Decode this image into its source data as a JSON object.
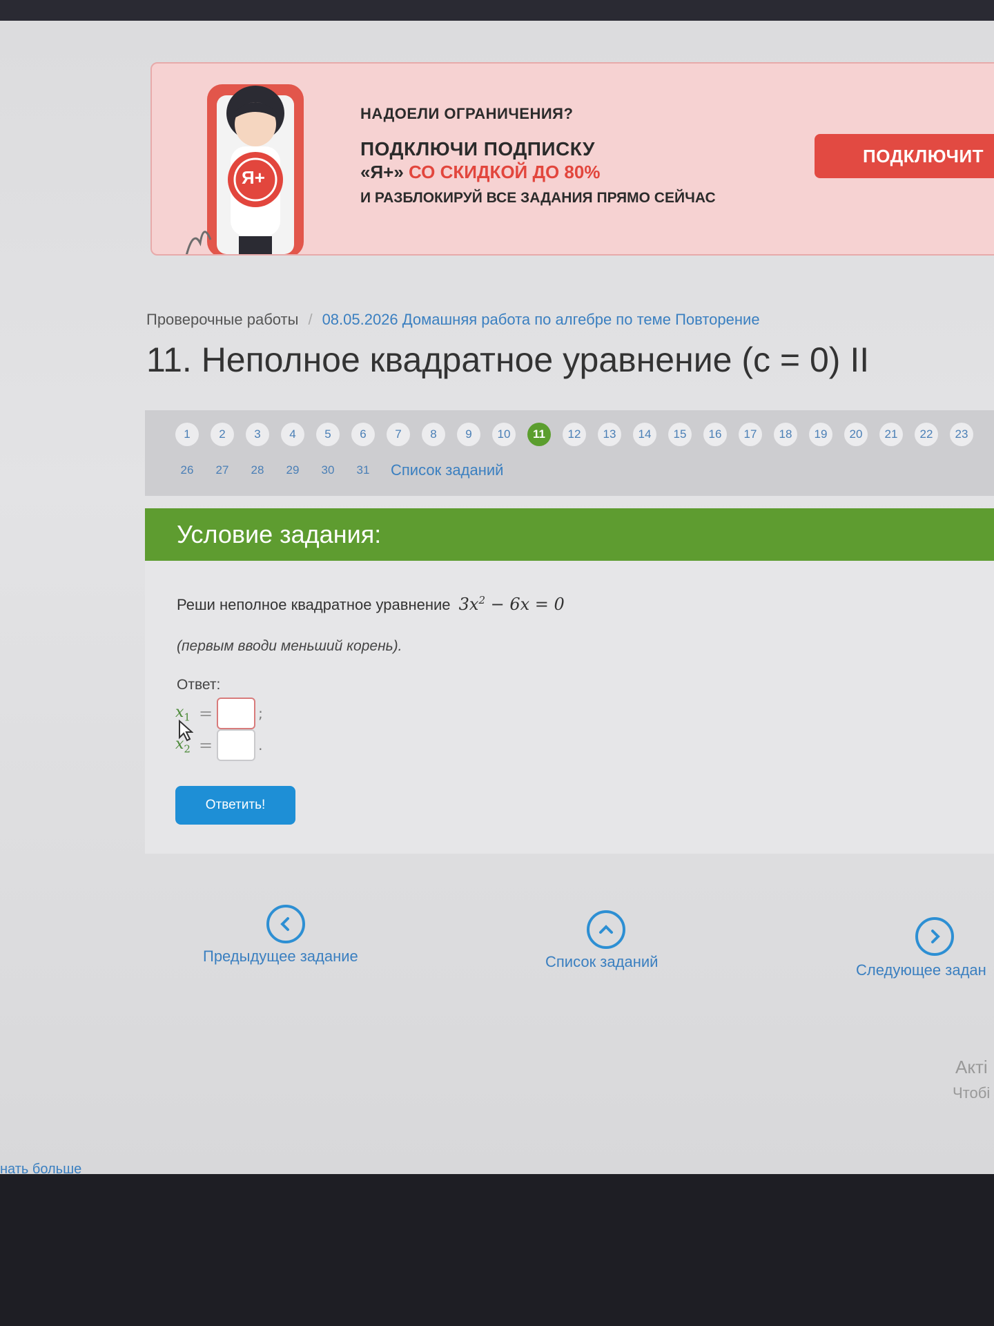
{
  "banner": {
    "line1": "НАДОЕЛИ ОГРАНИЧЕНИЯ?",
    "line2": "ПОДКЛЮЧИ ПОДПИСКУ",
    "line3_prefix": "«Я+»",
    "line3_accent": "СО СКИДКОЙ ДО 80%",
    "line4": "И РАЗБЛОКИРУЙ ВСЕ ЗАДАНИЯ ПРЯМО СЕЙЧАС",
    "button": "ПОДКЛЮЧИТ",
    "badge": "Я+",
    "accent_color": "#e2463d"
  },
  "breadcrumb": {
    "root": "Проверочные работы",
    "separator": "/",
    "current": "08.05.2026 Домашняя работа по алгебре по теме Повторение"
  },
  "title": "11. Неполное квадратное уравнение (c = 0) II",
  "task_nav": {
    "row1": [
      "1",
      "2",
      "3",
      "4",
      "5",
      "6",
      "7",
      "8",
      "9",
      "10",
      "11",
      "12",
      "13",
      "14",
      "15",
      "16",
      "17",
      "18",
      "19",
      "20",
      "21",
      "22",
      "23"
    ],
    "row2": [
      "26",
      "27",
      "28",
      "29",
      "30",
      "31"
    ],
    "active": "11",
    "list_link": "Список заданий"
  },
  "condition": {
    "header": "Условие задания:",
    "question_text": "Реши неполное квадратное уравнение",
    "equation_coef": "3x",
    "equation_power": "2",
    "equation_rest": " − 6x = 0",
    "hint": "(первым вводи меньший корень).",
    "answer_label": "Ответ:",
    "root1_var": "x",
    "root1_sub": "1",
    "root2_var": "x",
    "root2_sub": "2",
    "eq_sign": "=",
    "root1_value": "",
    "root2_value": "",
    "root1_punct": ";",
    "root2_punct": ".",
    "submit": "Ответить!"
  },
  "bottom_nav": {
    "prev": "Предыдущее задание",
    "list": "Список заданий",
    "next": "Следующее задан"
  },
  "side": {
    "activate_title": "Акті",
    "activate_sub": "Чтобі"
  },
  "footer": {
    "learn_more": "нать больше"
  },
  "colors": {
    "green": "#5e9c30",
    "blue_link": "#3a7fc0",
    "button_blue": "#1e8fd6",
    "banner_bg": "#f6d2d2"
  }
}
